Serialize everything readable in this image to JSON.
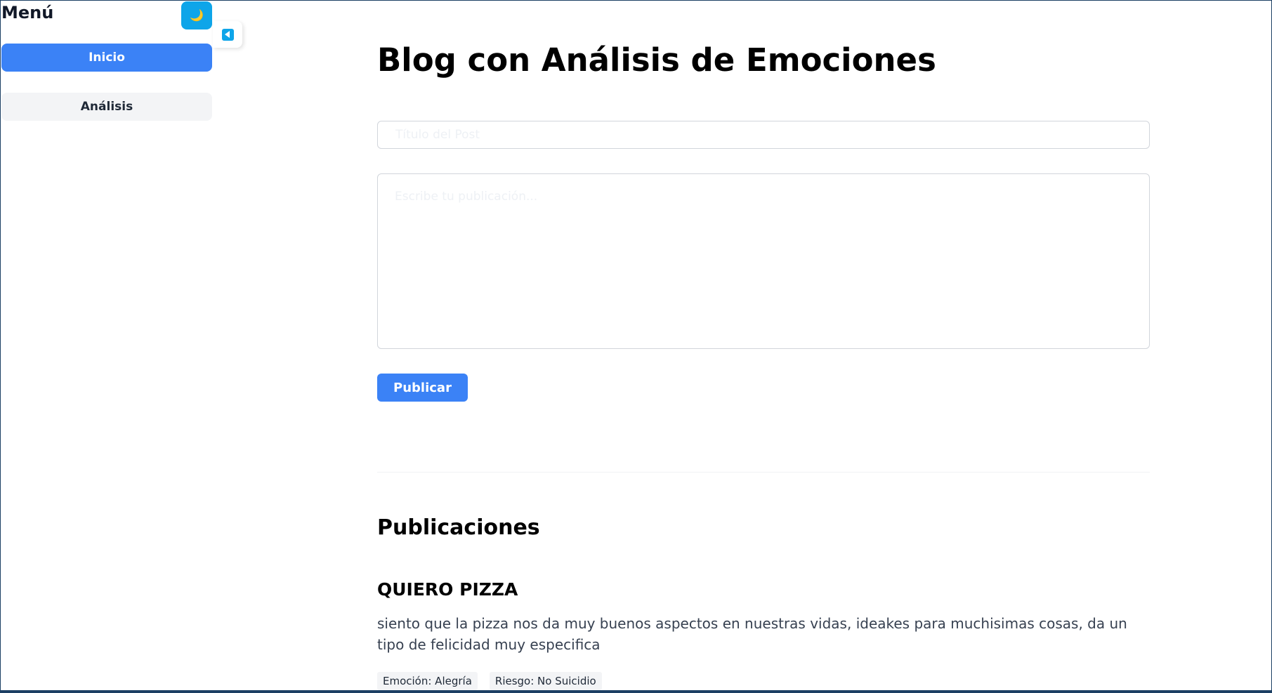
{
  "sidebar": {
    "title": "Menú",
    "theme_toggle_icon": "🌙",
    "items": [
      {
        "label": "Inicio",
        "active": true
      },
      {
        "label": "Análisis",
        "active": false
      }
    ],
    "collapse_icon": "collapse-left-icon"
  },
  "main": {
    "title": "Blog con Análisis de Emociones",
    "title_input": {
      "placeholder": "Título del Post",
      "value": ""
    },
    "content_input": {
      "placeholder": "Escribe tu publicación...",
      "value": ""
    },
    "publish_label": "Publicar"
  },
  "posts_section": {
    "title": "Publicaciones",
    "posts": [
      {
        "title": "QUIERO PIZZA",
        "body": "siento que la pizza nos da muy buenos aspectos en nuestras vidas, ideakes para muchisimas cosas, da un tipo de felicidad muy especifica",
        "emotion": "Emoción: Alegría",
        "risk": "Riesgo: No Suicidio"
      }
    ]
  },
  "colors": {
    "primary": "#3b82f6",
    "accent": "#0ea5e9",
    "tag_bg": "#f3f4f6",
    "frame_border": "#1c3f63"
  }
}
